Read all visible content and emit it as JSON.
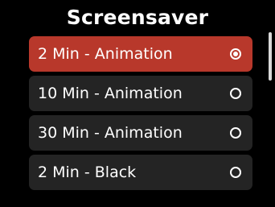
{
  "title": "Screensaver",
  "options": [
    {
      "label": "2 Min - Animation",
      "selected": true
    },
    {
      "label": "10 Min - Animation",
      "selected": false
    },
    {
      "label": "30 Min - Animation",
      "selected": false
    },
    {
      "label": "2 Min - Black",
      "selected": false
    }
  ],
  "colors": {
    "background": "#000000",
    "selected": "#b8382b",
    "item": "#242424",
    "text": "#ffffff",
    "scrollbar": "#d9d9d9"
  },
  "icons": {
    "radio_selected": "radio-checked-icon",
    "radio_unselected": "radio-unchecked-icon"
  }
}
